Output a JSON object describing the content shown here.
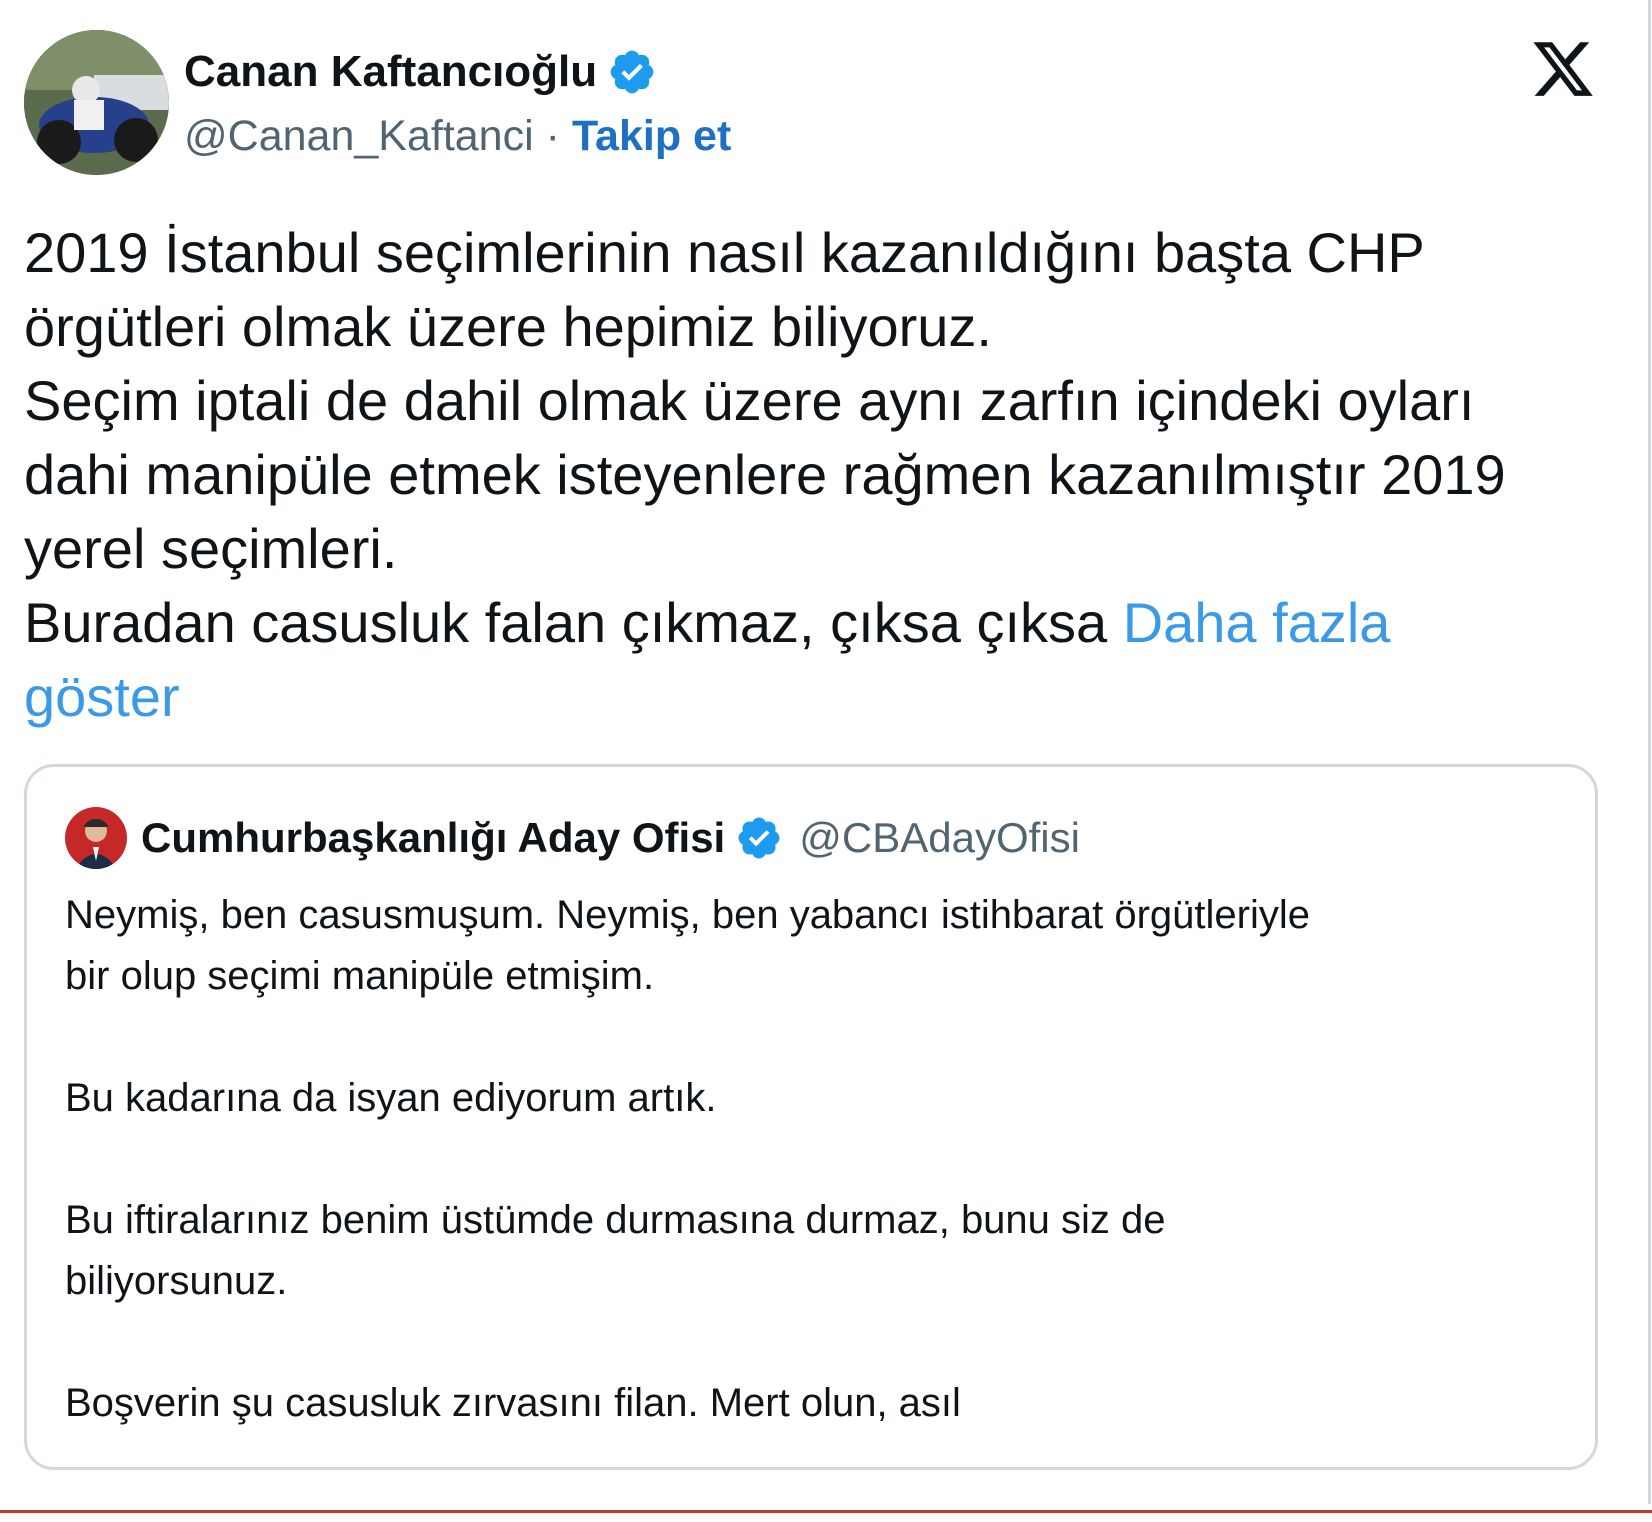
{
  "author": {
    "display_name": "Canan Kaftancıoğlu",
    "handle": "@Canan_Kaftanci",
    "separator": "·",
    "follow_label": "Takip et",
    "verified": true
  },
  "platform_icon": "x-logo-icon",
  "tweet": {
    "lines": [
      "2019 İstanbul seçimlerinin nasıl kazanıldığını başta CHP",
      "örgütleri olmak üzere hepimiz biliyoruz.",
      "Seçim iptali de dahil olmak üzere aynı zarfın içindeki oyları",
      "dahi manipüle etmek isteyenlere rağmen kazanılmıştır 2019",
      "yerel seçimleri.",
      "Buradan casusluk falan çıkmaz, çıksa çıksa "
    ],
    "show_more_part1": "Daha fazla",
    "show_more_part2": "göster"
  },
  "quoted": {
    "display_name": "Cumhurbaşkanlığı Aday Ofisi",
    "handle": "@CBAdayOfisi",
    "verified": true,
    "lines": [
      "Neymiş, ben casusmuşum. Neymiş, ben yabancı istihbarat örgütleriyle",
      "bir olup seçimi manipüle etmişim.",
      "",
      "Bu kadarına da isyan ediyorum artık.",
      "",
      "Bu iftiralarınız benim üstümde durmasına durmaz, bunu siz de",
      "biliyorsunuz.",
      "",
      "Boşverin şu casusluk zırvasını filan. Mert olun, asıl"
    ]
  },
  "colors": {
    "link": "#1d70c4",
    "show_more": "#3b9ae8",
    "verified_badge": "#1d9bf0",
    "text": "#0f1419",
    "muted": "#536471",
    "border": "#cfd9de"
  }
}
